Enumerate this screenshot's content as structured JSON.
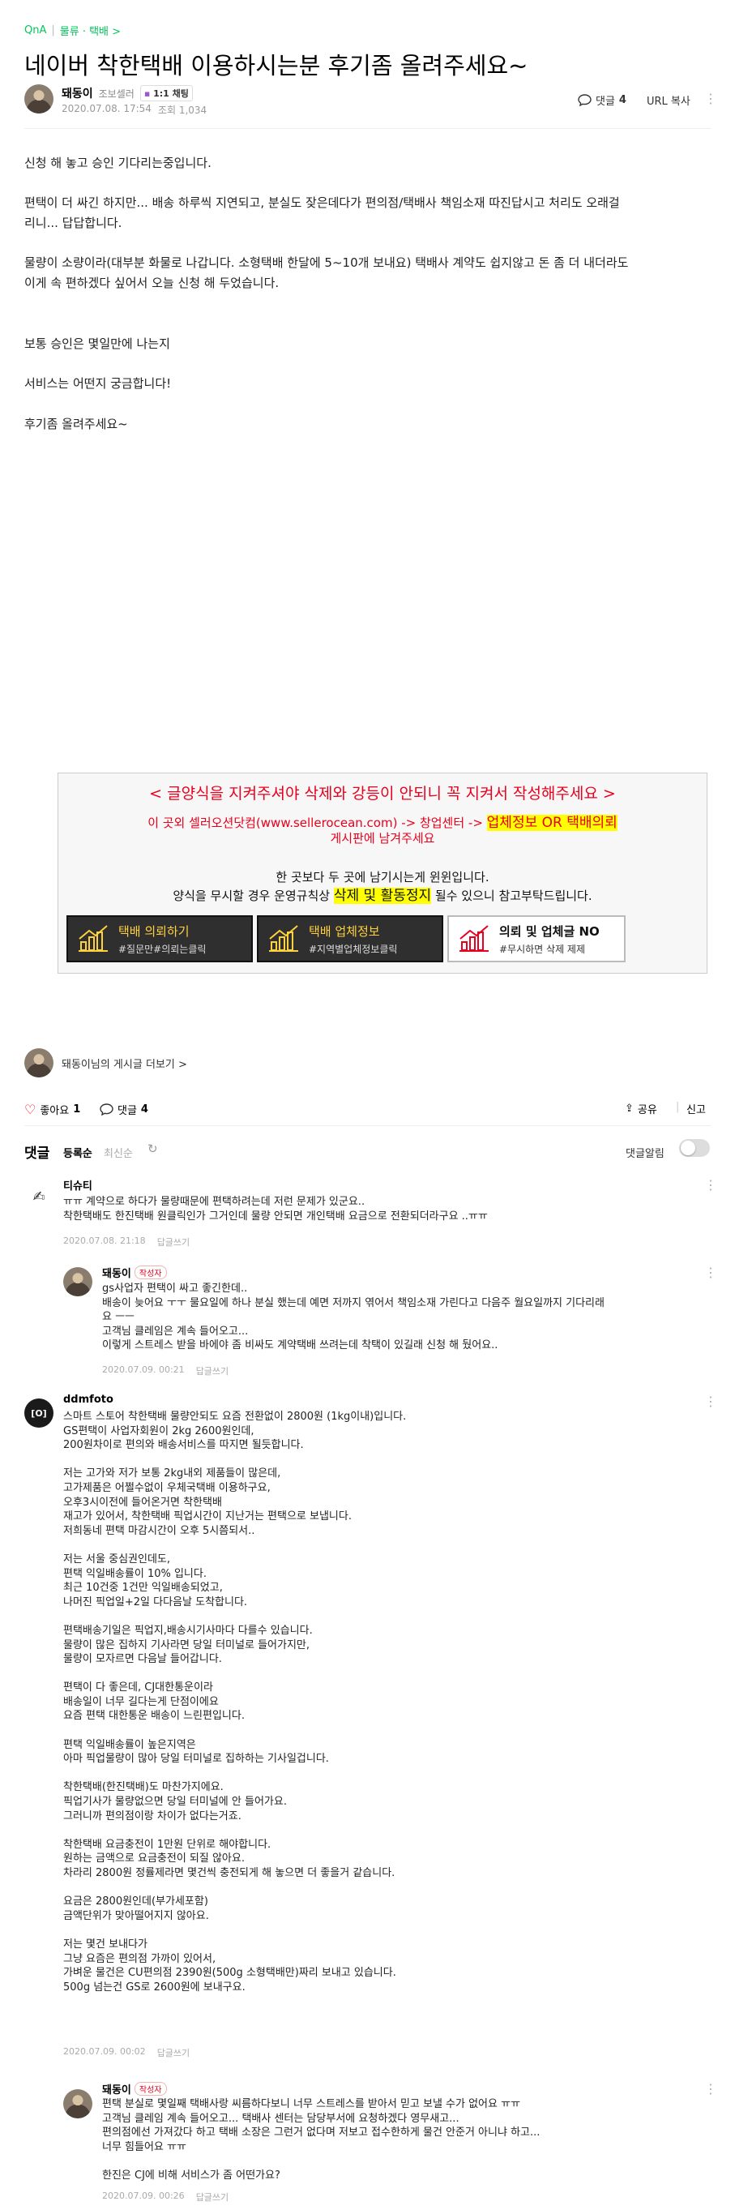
{
  "breadcrumb": {
    "board": "QnA",
    "category": "물류 · 택배 >"
  },
  "post": {
    "title": "네이버 착한택배 이용하시는분 후기좀 올려주세요~",
    "author": "돼동이",
    "grade": "조보셀러",
    "chat": "1:1 채팅",
    "date": "2020.07.08. 17:54",
    "views": "조회 1,034",
    "comment_label": "댓글",
    "comment_count": "4",
    "url_copy": "URL 복사",
    "body": [
      "신청 해 놓고 승인 기다리는중입니다.",
      "편택이 더 싸긴 하지만... 배송 하루씩 지연되고, 분실도 잦은데다가 편의점/택배사 책임소재 따진답시고 처리도 오래걸",
      "리니... 답답합니다.",
      "물량이 소량이라(대부분 화물로 나갑니다. 소형택배 한달에 5~10개 보내요) 택배사 계약도 쉽지않고 돈 좀 더 내더라도",
      "이게 속 편하겠다 싶어서 오늘 신청 해 두었습니다.",
      "보통 승인은 몇일만에 나는지",
      "서비스는 어떤지 궁금합니다!",
      "후기좀 올려주세요~"
    ]
  },
  "banner": {
    "line1": "< 글양식을 지켜주셔야 삭제와 강등이 안되니 꼭 지켜서 작성해주세요 >",
    "line2a": "이 곳외 셀러오션닷컴(www.sellerocean.com) -> 창업센터 -> ",
    "line2b": "업체정보 OR 택배의뢰",
    "line2c": "게시판에 남겨주세요",
    "line3": "한 곳보다 두 곳에 남기시는게 윈윈입니다.",
    "line4a": "양식을 무시할 경우 운영규칙상 ",
    "line4b": "삭제 및 활동정지",
    "line4c": " 될수 있으니 참고부탁드립니다.",
    "buttons": [
      {
        "title": "택배 의뢰하기",
        "sub": "#질문만#의뢰는클릭"
      },
      {
        "title": "택배 업체정보",
        "sub": "#지역별업체정보클릭"
      },
      {
        "title": "의뢰 및 업체글 NO",
        "sub": "#무시하면 삭제 제제"
      }
    ]
  },
  "more_posts": "돼동이님의 게시글 더보기 >",
  "actions": {
    "like": "좋아요",
    "like_count": "1",
    "comment": "댓글",
    "comment_count": "4",
    "share": "공유",
    "report": "신고"
  },
  "comments_header": {
    "title": "댓글",
    "sort_reg": "등록순",
    "sort_new": "최신순",
    "alarm": "댓글알림"
  },
  "comments": [
    {
      "name": "티슈티",
      "lines": [
        "ㅠㅠ 계약으로 하다가 물량때문에 편택하려는데 저런 문제가 있군요..",
        "착한택배도 한진택배 원클릭인가 그거인데 물량 안되면 개인택배 요금으로 전환되더라구요 ..ㅠㅠ"
      ],
      "date": "2020.07.08. 21:18",
      "reply": "답글쓰기"
    },
    {
      "name": "돼동이",
      "writer": "작성자",
      "lines": [
        "gs사업자 편택이 싸고 좋긴한데..",
        "배송이 늦어요 ㅜㅜ 물요일에 하나 분실 했는데 예면 저까지 엮어서 책임소재 가린다고 다음주 월요일까지 기다리래",
        "요 ㅡㅡ",
        "고객님 클레임은 계속 들어오고...",
        "이렇게 스트레스 받을 바에야 좀 비싸도 계약택배 쓰려는데 착택이 있길래 신청 해 뒀어요.."
      ],
      "date": "2020.07.09. 00:21",
      "reply": "답글쓰기"
    },
    {
      "name": "ddmfoto",
      "lines": [
        "스마트 스토어 착한택배 물량안되도 요즘 전환없이 2800원 (1kg이내)입니다.",
        "GS편택이 사업자회원이 2kg 2600원인데,",
        "200원차이로 편의와 배송서비스를 따지면 될듯합니다.",
        "",
        "저는 고가와 저가 보통 2kg내외 제품들이 많은데,",
        "고가제품은 어쩔수없이 우체국택배 이용하구요,",
        "오후3시이전에 들어온거면 착한택배",
        "재고가 있어서, 착한택배 픽업시간이 지난거는 편택으로 보냅니다.",
        "저희동네 편택 마감시간이 오후 5시쯤되서..",
        "",
        "저는 서울 중심권인데도,",
        "편택 익일배송률이 10% 입니다.",
        "최근 10건중 1건만 익일배송되었고,",
        "나머진 픽업일+2일 다다음날 도착합니다.",
        "",
        "편택배송기일은 픽업지,배송시기사마다 다를수 있습니다.",
        "물량이 많은 집하지 기사라면 당일 터미널로 들어가지만,",
        "물량이 모자르면 다음날 들어갑니다.",
        "",
        "편택이 다 좋은데, CJ대한통운이라",
        "배송일이 너무 길다는게 단점이에요",
        "요즘 편택 대한통운 배송이 느린편입니다.",
        "",
        "편택 익일배송률이 높은지역은",
        "아마 픽업물량이 많아 당일 터미널로 집하하는 기사일겁니다.",
        "",
        "착한택배(한진택배)도 마찬가지에요.",
        "픽업기사가 물량없으면 당일 터미널에 안 들어가요.",
        "그러니까 편의점이랑 차이가 없다는거죠.",
        "",
        "착한택배 요금충전이 1만원 단위로 해야합니다.",
        "원하는 금액으로 요금충전이 되질 않아요.",
        "차라리 2800원 정률제라면 몇건씩 충전되게 해 놓으면 더 좋을거 같습니다.",
        "",
        "요금은 2800원인데(부가세포함)",
        "금액단위가 맞아떨어지지 않아요.",
        "",
        "저는 몇건 보내다가",
        "그냥 요즘은 편의점 가까이 있어서,",
        "가벼운 물건은 CU편의점 2390원(500g 소형택배만)짜리 보내고 있습니다.",
        "500g 넘는건 GS로 2600원에 보내구요."
      ],
      "date": "2020.07.09. 00:02",
      "reply": "답글쓰기"
    },
    {
      "name": "돼동이",
      "writer": "작성자",
      "lines": [
        "편택 분실로 몇일째 택배사랑 씨름하다보니 너무 스트레스를 받아서 믿고 보낼 수가 없어요 ㅠㅠ",
        "고객님 클레임 계속 들어오고... 택배사 센터는 담당부서에 요청하겠다 영무새고...",
        "편의점에선 가져갔다 하고 택배 소장은 그런거 없다며 저보고 접수한하게 물건 안준거 아니냐 하고...",
        "너무 힘들어요 ㅠㅠ",
        "",
        "한진은 CJ에 비해 서비스가 좀 어떤가요?"
      ],
      "date": "2020.07.09. 00:26",
      "reply": "답글쓰기"
    }
  ]
}
